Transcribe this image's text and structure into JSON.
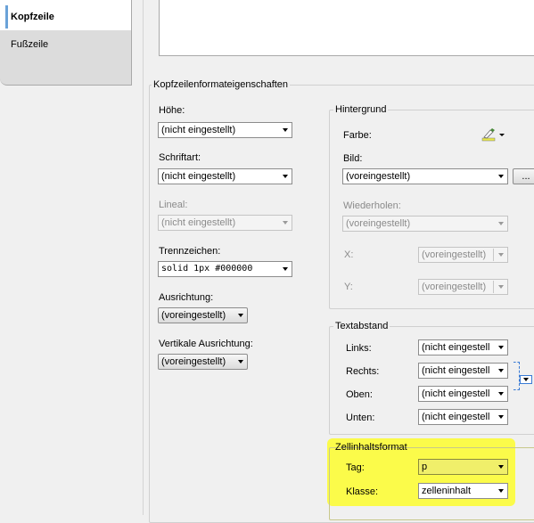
{
  "tabs": {
    "active": "Kopfzeile",
    "second": "Fußzeile"
  },
  "properties": {
    "title": "Kopfzeilenformateigenschaften",
    "hoehe": {
      "label": "Höhe:",
      "value": "(nicht eingestellt)"
    },
    "schriftart": {
      "label": "Schriftart:",
      "value": "(nicht eingestellt)"
    },
    "lineal": {
      "label": "Lineal:",
      "value": "(nicht eingestellt)"
    },
    "trennzeichen": {
      "label": "Trennzeichen:",
      "value": "solid 1px #000000"
    },
    "ausrichtung": {
      "label": "Ausrichtung:",
      "value": "(voreingestellt)"
    },
    "vertikal": {
      "label": "Vertikale Ausrichtung:",
      "value": "(voreingestellt)"
    }
  },
  "hintergrund": {
    "title": "Hintergrund",
    "farbe_label": "Farbe:",
    "bild_label": "Bild:",
    "bild_value": "(voreingestellt)",
    "browse_label": "...",
    "wiederholen_label": "Wiederholen:",
    "wiederholen_value": "(voreingestellt)",
    "x_label": "X:",
    "x_value": "(voreingestellt)",
    "y_label": "Y:",
    "y_value": "(voreingestellt)"
  },
  "textabstand": {
    "title": "Textabstand",
    "links": {
      "label": "Links:",
      "value": "(nicht eingestell"
    },
    "rechts": {
      "label": "Rechts:",
      "value": "(nicht eingestell"
    },
    "oben": {
      "label": "Oben:",
      "value": "(nicht eingestell"
    },
    "unten": {
      "label": "Unten:",
      "value": "(nicht eingestell"
    }
  },
  "zellinhalt": {
    "title": "Zellinhaltsformat",
    "tag": {
      "label": "Tag:",
      "value": "p"
    },
    "klasse": {
      "label": "Klasse:",
      "value": "zelleninhalt"
    }
  },
  "colors": {
    "highlight": "#fcfc3c",
    "active_tab_bar": "#6aa2d8"
  }
}
